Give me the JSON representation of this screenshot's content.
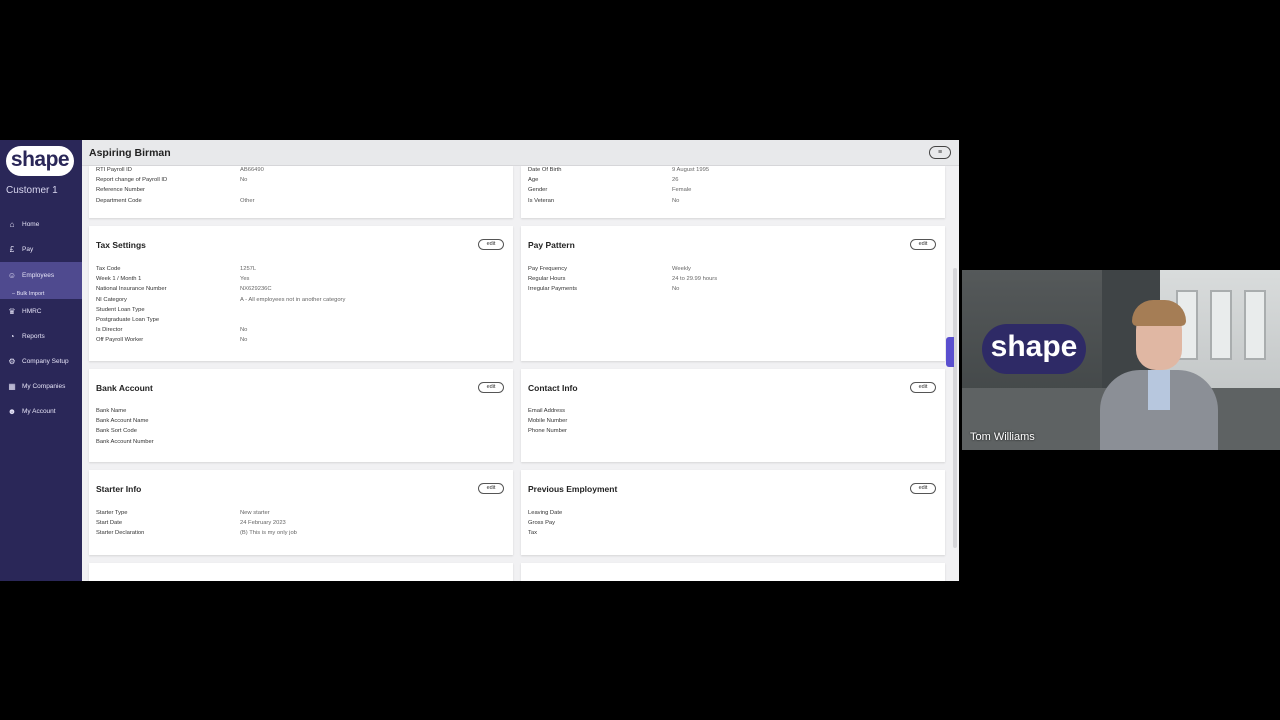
{
  "app": {
    "logo_text": "shape",
    "customer": "Customer 1"
  },
  "sidebar": {
    "items": [
      {
        "label": "Home",
        "icon": "home-icon",
        "glyph": "⌂"
      },
      {
        "label": "Pay",
        "icon": "pound-icon",
        "glyph": "£"
      },
      {
        "label": "Employees",
        "icon": "employees-icon",
        "glyph": "☺"
      },
      {
        "label": "HMRC",
        "icon": "hmrc-icon",
        "glyph": "♛"
      },
      {
        "label": "Reports",
        "icon": "reports-icon",
        "glyph": "◔"
      },
      {
        "label": "Company Setup",
        "icon": "gear-icon",
        "glyph": "⚙"
      },
      {
        "label": "My Companies",
        "icon": "building-icon",
        "glyph": "▦"
      },
      {
        "label": "My Account",
        "icon": "user-icon",
        "glyph": "☻"
      }
    ],
    "sub_item": "– Bulk Import",
    "active_color": "#4f4a8f",
    "bg_color": "#2a2758"
  },
  "header": {
    "employee_name": "Aspiring Birman",
    "menu_glyph": "≡"
  },
  "cards": {
    "top_left": {
      "rows": [
        {
          "label": "RTI Payroll ID",
          "value": "AB66490"
        },
        {
          "label": "Report change of Payroll ID",
          "value": "No"
        },
        {
          "label": "Reference Number",
          "value": ""
        },
        {
          "label": "Department Code",
          "value": "Other"
        }
      ]
    },
    "top_right": {
      "rows": [
        {
          "label": "Date Of Birth",
          "value": "9 August 1995"
        },
        {
          "label": "Age",
          "value": "26"
        },
        {
          "label": "Gender",
          "value": "Female"
        },
        {
          "label": "Is Veteran",
          "value": "No"
        }
      ]
    },
    "tax_settings": {
      "title": "Tax Settings",
      "edit": "edit",
      "rows": [
        {
          "label": "Tax Code",
          "value": "1257L"
        },
        {
          "label": "Week 1 / Month 1",
          "value": "Yes"
        },
        {
          "label": "National Insurance Number",
          "value": "NX629236C"
        },
        {
          "label": "NI Category",
          "value": "A - All employees not in another category"
        },
        {
          "label": "Student Loan Type",
          "value": ""
        },
        {
          "label": "Postgraduate Loan Type",
          "value": ""
        },
        {
          "label": "Is Director",
          "value": "No"
        },
        {
          "label": "Off Payroll Worker",
          "value": "No"
        }
      ]
    },
    "pay_pattern": {
      "title": "Pay Pattern",
      "edit": "edit",
      "rows": [
        {
          "label": "Pay Frequency",
          "value": "Weekly"
        },
        {
          "label": "Regular Hours",
          "value": "24 to 29.99 hours"
        },
        {
          "label": "Irregular Payments",
          "value": "No"
        }
      ]
    },
    "bank_account": {
      "title": "Bank Account",
      "edit": "edit",
      "rows": [
        {
          "label": "Bank Name",
          "value": ""
        },
        {
          "label": "Bank Account Name",
          "value": ""
        },
        {
          "label": "Bank Sort Code",
          "value": ""
        },
        {
          "label": "Bank Account Number",
          "value": ""
        }
      ]
    },
    "contact_info": {
      "title": "Contact Info",
      "edit": "edit",
      "rows": [
        {
          "label": "Email Address",
          "value": ""
        },
        {
          "label": "Mobile Number",
          "value": ""
        },
        {
          "label": "Phone Number",
          "value": ""
        }
      ]
    },
    "starter_info": {
      "title": "Starter Info",
      "edit": "edit",
      "rows": [
        {
          "label": "Starter Type",
          "value": "New starter"
        },
        {
          "label": "Start Date",
          "value": "24 February 2023"
        },
        {
          "label": "Starter Declaration",
          "value": "(B) This is my only job"
        }
      ]
    },
    "previous_employment": {
      "title": "Previous Employment",
      "edit": "edit",
      "rows": [
        {
          "label": "Leaving Date",
          "value": ""
        },
        {
          "label": "Gross Pay",
          "value": ""
        },
        {
          "label": "Tax",
          "value": ""
        }
      ]
    }
  },
  "video": {
    "logo_text": "shape",
    "presenter": "Tom Williams"
  }
}
